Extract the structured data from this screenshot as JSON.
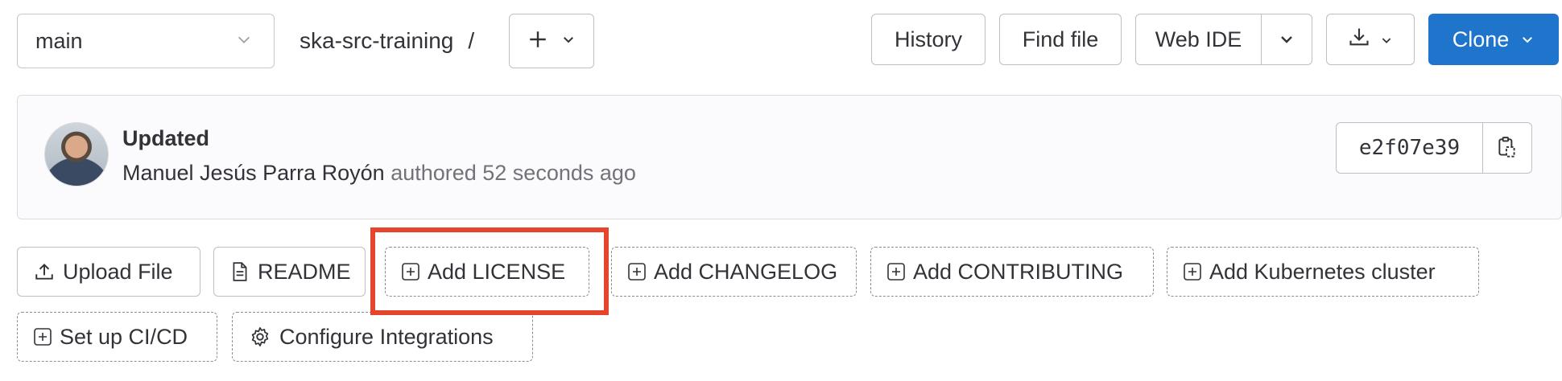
{
  "toolbar": {
    "branch": "main",
    "project_name": "ska-src-training",
    "crumb_separator": "/",
    "buttons": {
      "history": "History",
      "find_file": "Find file",
      "web_ide": "Web IDE",
      "clone": "Clone"
    }
  },
  "commit": {
    "title": "Updated",
    "author": "Manuel Jesús Parra Royón",
    "authored_text": "authored 52 seconds ago",
    "sha": "e2f07e39"
  },
  "actions": {
    "upload_file": "Upload File",
    "readme": "README",
    "add_license": "Add LICENSE",
    "add_changelog": "Add CHANGELOG",
    "add_contributing": "Add CONTRIBUTING",
    "add_kubernetes": "Add Kubernetes cluster",
    "setup_cicd": "Set up CI/CD",
    "configure_integrations": "Configure Integrations"
  },
  "colors": {
    "primary": "#1f75cb",
    "highlight": "#e5452c",
    "muted_text": "#737278"
  },
  "icons": {
    "branch_caret": "chevron-down-icon",
    "add": "plus-icon",
    "download": "download-icon",
    "copy": "copy-to-clipboard-icon",
    "upload": "upload-icon",
    "document": "document-icon",
    "plus_square": "plus-square-icon",
    "settings": "gear-icon"
  }
}
